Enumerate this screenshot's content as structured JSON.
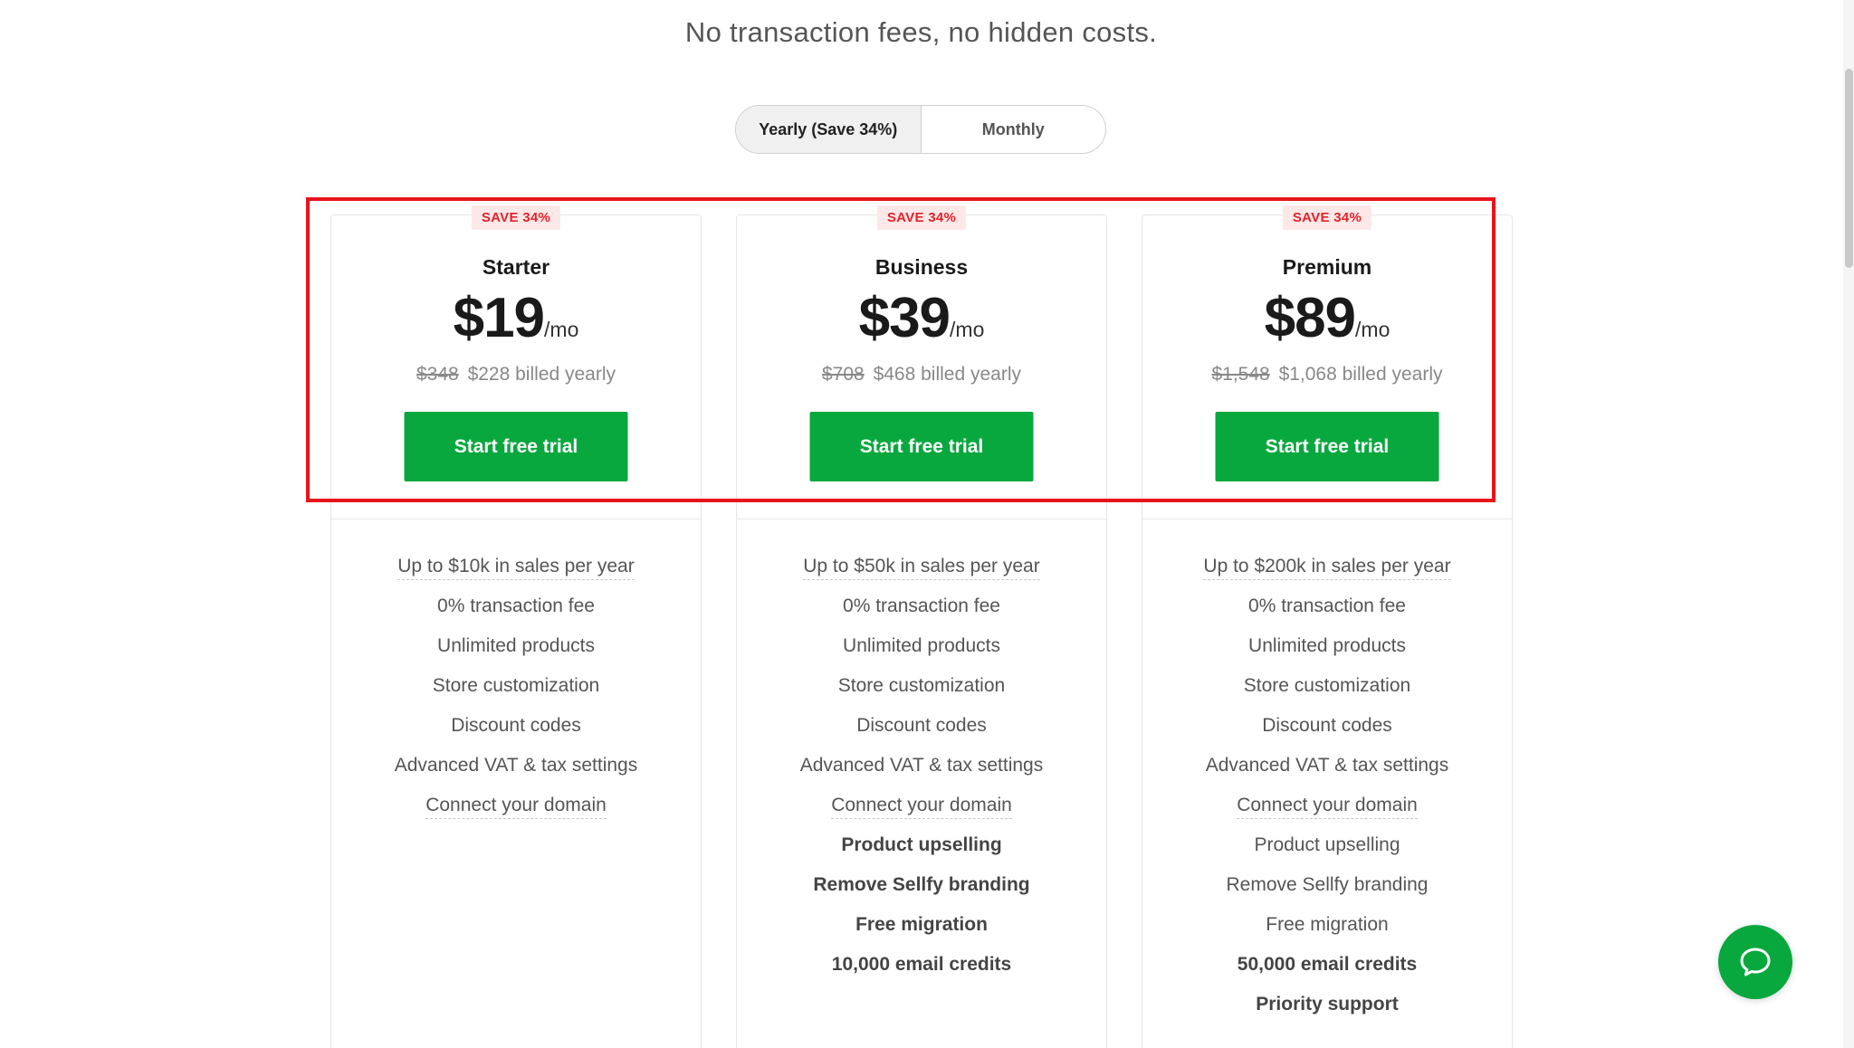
{
  "header": {
    "subtitle": "No transaction fees, no hidden costs."
  },
  "billing_toggle": {
    "yearly_label": "Yearly (Save 34%)",
    "monthly_label": "Monthly",
    "selected": "Yearly (Save 34%)"
  },
  "plans": [
    {
      "badge": "SAVE 34%",
      "name": "Starter",
      "price": "$19",
      "per": "/mo",
      "old_price": "$348",
      "billed": "$228 billed yearly",
      "cta": "Start free trial",
      "features": [
        {
          "text": "Up to $10k in sales per year",
          "bold": false,
          "dotted": true
        },
        {
          "text": "0% transaction fee",
          "bold": false,
          "dotted": false
        },
        {
          "text": "Unlimited products",
          "bold": false,
          "dotted": false
        },
        {
          "text": "Store customization",
          "bold": false,
          "dotted": false
        },
        {
          "text": "Discount codes",
          "bold": false,
          "dotted": false
        },
        {
          "text": "Advanced VAT & tax settings",
          "bold": false,
          "dotted": false
        },
        {
          "text": "Connect your domain",
          "bold": false,
          "dotted": true
        }
      ]
    },
    {
      "badge": "SAVE 34%",
      "name": "Business",
      "price": "$39",
      "per": "/mo",
      "old_price": "$708",
      "billed": "$468 billed yearly",
      "cta": "Start free trial",
      "features": [
        {
          "text": "Up to $50k in sales per year",
          "bold": false,
          "dotted": true
        },
        {
          "text": "0% transaction fee",
          "bold": false,
          "dotted": false
        },
        {
          "text": "Unlimited products",
          "bold": false,
          "dotted": false
        },
        {
          "text": "Store customization",
          "bold": false,
          "dotted": false
        },
        {
          "text": "Discount codes",
          "bold": false,
          "dotted": false
        },
        {
          "text": "Advanced VAT & tax settings",
          "bold": false,
          "dotted": false
        },
        {
          "text": "Connect your domain",
          "bold": false,
          "dotted": true
        },
        {
          "text": "Product upselling",
          "bold": true,
          "dotted": false
        },
        {
          "text": "Remove Sellfy branding",
          "bold": true,
          "dotted": false
        },
        {
          "text": "Free migration",
          "bold": true,
          "dotted": false
        },
        {
          "text": "10,000 email credits",
          "bold": true,
          "dotted": false
        }
      ]
    },
    {
      "badge": "SAVE 34%",
      "name": "Premium",
      "price": "$89",
      "per": "/mo",
      "old_price": "$1,548",
      "billed": "$1,068 billed yearly",
      "cta": "Start free trial",
      "features": [
        {
          "text": "Up to $200k in sales per year",
          "bold": false,
          "dotted": true
        },
        {
          "text": "0% transaction fee",
          "bold": false,
          "dotted": false
        },
        {
          "text": "Unlimited products",
          "bold": false,
          "dotted": false
        },
        {
          "text": "Store customization",
          "bold": false,
          "dotted": false
        },
        {
          "text": "Discount codes",
          "bold": false,
          "dotted": false
        },
        {
          "text": "Advanced VAT & tax settings",
          "bold": false,
          "dotted": false
        },
        {
          "text": "Connect your domain",
          "bold": false,
          "dotted": true
        },
        {
          "text": "Product upselling",
          "bold": false,
          "dotted": false
        },
        {
          "text": "Remove Sellfy branding",
          "bold": false,
          "dotted": false
        },
        {
          "text": "Free migration",
          "bold": false,
          "dotted": false
        },
        {
          "text": "50,000 email credits",
          "bold": true,
          "dotted": false
        },
        {
          "text": "Priority support",
          "bold": true,
          "dotted": false
        }
      ]
    }
  ],
  "colors": {
    "cta_green": "#08a83f",
    "badge_red": "#e0242b",
    "highlight_red": "#e8141c"
  },
  "chat": {
    "icon": "chat-bubble-icon"
  }
}
